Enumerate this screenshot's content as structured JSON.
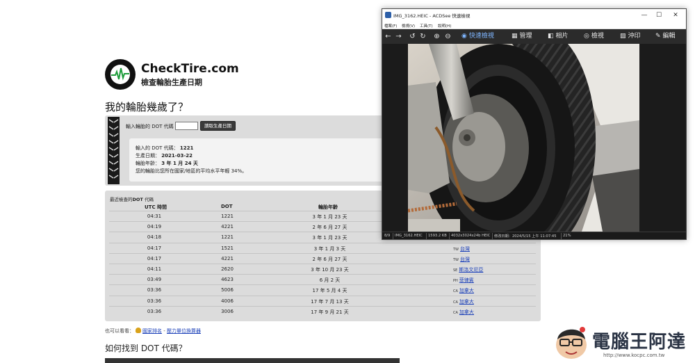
{
  "site": {
    "brand": "CheckTire.com",
    "tagline": "檢查輪胎生產日期",
    "heading": "我的輪胎幾歲了？",
    "checker": {
      "input_label": "輸入輪胎的 DOT 代碼",
      "input_value": "",
      "button_label": "讀取生產日期",
      "result": {
        "dot_label": "輸入的 DOT 代碼：",
        "dot_value": "1221",
        "date_label": "生產日期：",
        "date_value": "2021-03-22",
        "age_label": "輪胎年齡：",
        "age_value": "3 年 1 月 24 天",
        "compare_text": "您的輪胎比您所在國家/地區的平均水平年輕 34%。"
      }
    },
    "recent": {
      "title_prefix": "最近檢查的",
      "title_bold": "DOT",
      "title_suffix": "代碼",
      "columns": {
        "utc": "UTC 時間",
        "dot": "DOT",
        "age": "輪胎年齡"
      },
      "rows": [
        {
          "utc": "04:31",
          "dot": "1221",
          "age": "3 年 1 月 23 天",
          "cc": "",
          "country": ""
        },
        {
          "utc": "04:19",
          "dot": "4221",
          "age": "2 年 6 月 27 天",
          "cc": "",
          "country": ""
        },
        {
          "utc": "04:18",
          "dot": "1221",
          "age": "3 年 1 月 23 天",
          "cc": "",
          "country": ""
        },
        {
          "utc": "04:17",
          "dot": "1521",
          "age": "3 年 1 月 3 天",
          "cc": "TW",
          "country": "台灣"
        },
        {
          "utc": "04:17",
          "dot": "4221",
          "age": "2 年 6 月 27 天",
          "cc": "TW",
          "country": "台灣"
        },
        {
          "utc": "04:11",
          "dot": "2620",
          "age": "3 年 10 月 23 天",
          "cc": "SE",
          "country": "斯洛文尼亞"
        },
        {
          "utc": "03:49",
          "dot": "4623",
          "age": "6 月 2 天",
          "cc": "PH",
          "country": "菲律賓"
        },
        {
          "utc": "03:36",
          "dot": "5006",
          "age": "17 年 5 月 4 天",
          "cc": "CA",
          "country": "加拿大"
        },
        {
          "utc": "03:36",
          "dot": "4006",
          "age": "17 年 7 月 13 天",
          "cc": "CA",
          "country": "加拿大"
        },
        {
          "utc": "03:36",
          "dot": "3006",
          "age": "17 年 9 月 21 天",
          "cc": "CA",
          "country": "加拿大"
        }
      ]
    },
    "see_also": {
      "prefix": "也可以看看：",
      "link1": "國家排名",
      "separator": " - ",
      "link2": "壓力單位換算器"
    },
    "heading2": "如何找到 DOT 代碼？"
  },
  "acdsee": {
    "title": "IMG_3162.HEIC - ACDSee 快速檢視",
    "window_buttons": {
      "minimize": "—",
      "maximize": "☐",
      "close": "✕"
    },
    "menu": [
      "檔案(F)",
      "檢視(V)",
      "工具(T)",
      "說明(H)"
    ],
    "modes": [
      {
        "label": "快速檢視",
        "glyph": "◉",
        "active": true
      },
      {
        "label": "管理",
        "glyph": "▦",
        "active": false
      },
      {
        "label": "相片",
        "glyph": "◧",
        "active": false
      },
      {
        "label": "檢視",
        "glyph": "◎",
        "active": false
      },
      {
        "label": "沖印",
        "glyph": "▨",
        "active": false
      },
      {
        "label": "編輯",
        "glyph": "✎",
        "active": false
      }
    ],
    "status": {
      "index": "8/9",
      "filename": "IMG_3162.HEIC",
      "size": "1593.2 KB",
      "dims": "4032x3024x24b HEIC",
      "modified": "修改日期：2024/5/15 上午 11:07:45",
      "zoom": "21%"
    }
  },
  "watermark": {
    "title": "電腦王阿達",
    "url": "http://www.kocpc.com.tw"
  },
  "colors": {
    "panel_gray": "#dcdcdc",
    "link_blue": "#1a3fb8",
    "acdsee_accent": "#7fb6ff",
    "acdsee_bg": "#1e1e1e"
  }
}
